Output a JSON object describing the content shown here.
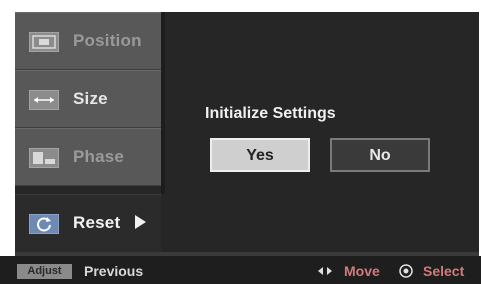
{
  "menu": {
    "items": [
      {
        "label": "Position",
        "icon": "position-icon"
      },
      {
        "label": "Size",
        "icon": "size-icon"
      },
      {
        "label": "Phase",
        "icon": "phase-icon"
      },
      {
        "label": "Reset",
        "icon": "reset-icon"
      }
    ]
  },
  "dialog": {
    "title": "Initialize Settings",
    "yes_label": "Yes",
    "no_label": "No"
  },
  "footer": {
    "adjust_label": "Adjust",
    "previous_label": "Previous",
    "move_label": "Move",
    "select_label": "Select"
  },
  "colors": {
    "osd_background": "#262626",
    "menu_item": "#585858",
    "accent_hint": "#d17b7b",
    "selected_button": "#cfcfcf"
  }
}
